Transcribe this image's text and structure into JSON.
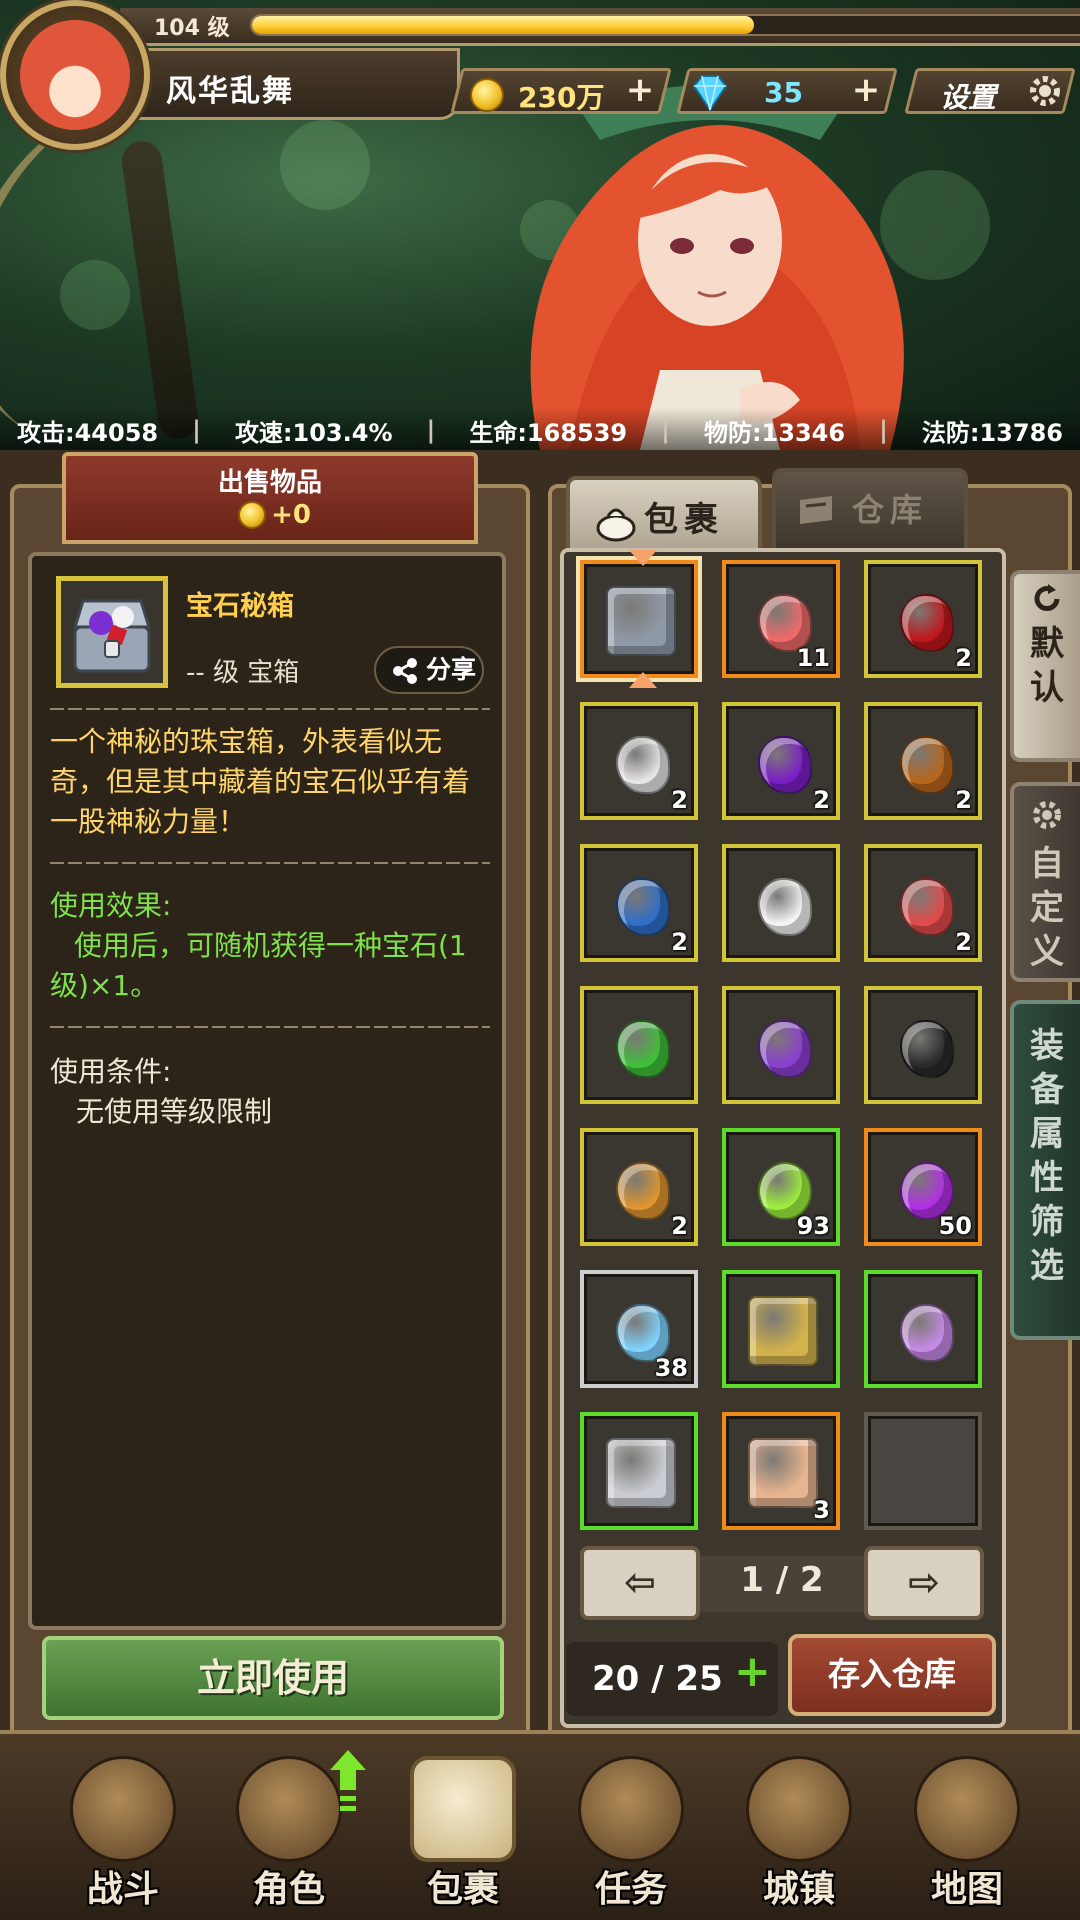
{
  "player": {
    "level_label": "104 级",
    "name": "风华乱舞",
    "xp_fraction": 0.6
  },
  "currency": {
    "gold": "230万",
    "gems": "35",
    "settings_label": "设置"
  },
  "stats": [
    {
      "text": "攻击:44058"
    },
    {
      "text": "攻速:103.4%"
    },
    {
      "text": "生命:168539"
    },
    {
      "text": "物防:13346"
    },
    {
      "text": "法防:13786"
    }
  ],
  "sell": {
    "title": "出售物品",
    "value": "+0"
  },
  "item": {
    "name": "宝石秘箱",
    "level_type": "-- 级 宝箱",
    "share_label": "分享",
    "description": "一个神秘的珠宝箱，外表看似无奇，但是其中藏着的宝石似乎有着一股神秘力量！",
    "effect_title": "使用效果:",
    "effect_text": "使用后，可随机获得一种宝石(1级)×1。",
    "condition_title": "使用条件:",
    "condition_text": "无使用等级限制",
    "use_button": "立即使用"
  },
  "tabs": {
    "bag": "包裹",
    "storage": "仓库"
  },
  "side_tabs": {
    "default": "默认",
    "custom": "自定义",
    "filter": "装备属性筛选"
  },
  "slots": [
    {
      "name": "treasure-chest",
      "count": "",
      "border": "orange",
      "color": "#8f9aa8",
      "selected": true
    },
    {
      "name": "red-crystal",
      "count": "11",
      "border": "orange",
      "color": "#f06a6a"
    },
    {
      "name": "red-gem",
      "count": "2",
      "border": "yellow",
      "color": "#c0171c"
    },
    {
      "name": "white-gem",
      "count": "2",
      "border": "yellow",
      "color": "#e6e6e6"
    },
    {
      "name": "purple-gem",
      "count": "2",
      "border": "yellow",
      "color": "#7a1fc6"
    },
    {
      "name": "amber-gem",
      "count": "2",
      "border": "yellow",
      "color": "#b8661b"
    },
    {
      "name": "blue-gem",
      "count": "2",
      "border": "yellow",
      "color": "#2f6fc8"
    },
    {
      "name": "white-gem",
      "count": "",
      "border": "yellow",
      "color": "#f4f4f4"
    },
    {
      "name": "red-gem",
      "count": "2",
      "border": "yellow",
      "color": "#e24b4b"
    },
    {
      "name": "green-gem",
      "count": "",
      "border": "yellow",
      "color": "#3fbf3a"
    },
    {
      "name": "violet-gem",
      "count": "",
      "border": "yellow",
      "color": "#8b3fd1"
    },
    {
      "name": "black-gem",
      "count": "",
      "border": "yellow",
      "color": "#2a2a2a"
    },
    {
      "name": "orange-gem",
      "count": "2",
      "border": "yellow",
      "color": "#e0962f"
    },
    {
      "name": "green-orb",
      "count": "93",
      "border": "green",
      "color": "#9cf03c"
    },
    {
      "name": "purple-orb",
      "count": "50",
      "border": "orange",
      "color": "#b22ee8"
    },
    {
      "name": "ice-crystal",
      "count": "38",
      "border": "white",
      "color": "#7fd3ff"
    },
    {
      "name": "shield-scroll",
      "count": "",
      "border": "green",
      "color": "#d2b24c"
    },
    {
      "name": "purple-ribbon",
      "count": "",
      "border": "green",
      "color": "#c68ae6"
    },
    {
      "name": "leg-armor",
      "count": "",
      "border": "green",
      "color": "#c9ccd2"
    },
    {
      "name": "parchment",
      "count": "3",
      "border": "orange",
      "color": "#e7b48f"
    },
    {
      "name": "empty",
      "count": "",
      "border": "empty",
      "color": ""
    }
  ],
  "pager": {
    "page": "1 / 2"
  },
  "capacity": {
    "text": "20 / 25",
    "store_button": "存入仓库"
  },
  "nav": [
    {
      "id": "battle",
      "label": "战斗"
    },
    {
      "id": "role",
      "label": "角色"
    },
    {
      "id": "bag",
      "label": "包裹"
    },
    {
      "id": "quest",
      "label": "任务"
    },
    {
      "id": "town",
      "label": "城镇"
    },
    {
      "id": "map",
      "label": "地图"
    }
  ],
  "colors": {
    "accent_gold": "#ffe37c",
    "effect_green": "#7fe24a",
    "desc_yellow": "#ffd46a"
  }
}
